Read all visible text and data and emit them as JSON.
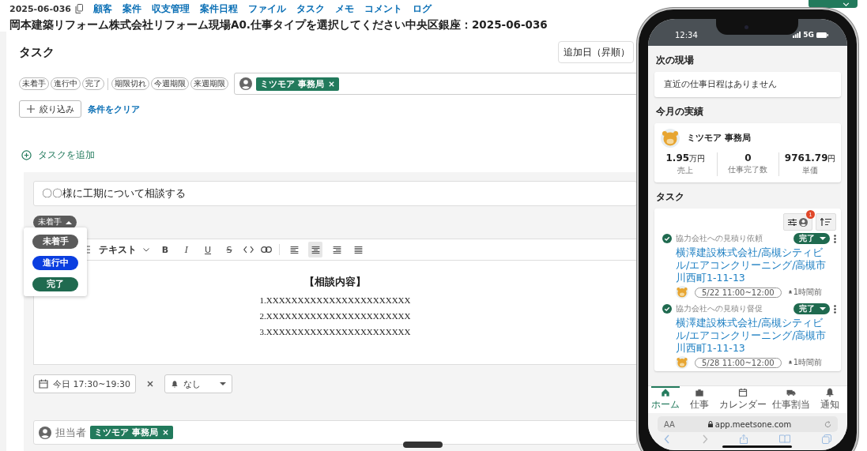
{
  "header": {
    "case_id": "2025-06-036",
    "nav": [
      "顧客",
      "案件",
      "収支管理",
      "案件日程",
      "ファイル",
      "タスク",
      "メモ",
      "コメント",
      "ログ"
    ],
    "title": "岡本建築リフォーム株式会社リフォーム現場A0.仕事タイプを選択してください中央区銀座：2025-06-036"
  },
  "tasks_panel": {
    "title": "タスク",
    "sort": "追加日（昇順）",
    "status_filters": [
      "未着手",
      "進行中",
      "完了"
    ],
    "deadline_filters": [
      "期限切れ",
      "今週期限",
      "来週期限"
    ],
    "assignee_tags": [
      "ミツモア 事務局"
    ],
    "filter_button": "絞り込み",
    "clear_link": "条件をクリア",
    "add_task": "タスクを追加"
  },
  "task_editor": {
    "title": "〇〇様に工期について相談する",
    "status": "未着手",
    "status_menu": [
      {
        "label": "未着手",
        "color": "#5b5b5b"
      },
      {
        "label": "進行中",
        "color": "#0a3ee0"
      },
      {
        "label": "完了",
        "color": "#1f6a4f"
      }
    ],
    "toolbar": {
      "text_style": "テキスト",
      "formats": [
        "B",
        "I",
        "U",
        "S"
      ],
      "alignments": [
        {
          "selected": false
        },
        {
          "selected": true
        },
        {
          "selected": false
        },
        {
          "selected": false
        }
      ]
    },
    "content": {
      "heading": "【相談内容】",
      "lines": [
        "1.XXXXXXXXXXXXXXXXXXXXXXX",
        "2.XXXXXXXXXXXXXXXXXXXXXXX",
        "3.XXXXXXXXXXXXXXXXXXXXXXX"
      ]
    },
    "schedule": "今日 17:30~19:30",
    "reminder": "なし",
    "assignee": {
      "placeholder": "担当者",
      "tags": [
        "ミツモア 事務局"
      ]
    }
  },
  "phone": {
    "time": "12:34",
    "network": "5G",
    "next_site": {
      "title": "次の現場",
      "empty": "直近の仕事日程はありません"
    },
    "monthly": {
      "title": "今月の実績",
      "user": "ミツモア 事務局",
      "stats": [
        {
          "value": "1.95",
          "unit": "万円",
          "label": "売上"
        },
        {
          "value": "0",
          "label": "仕事完了数"
        },
        {
          "value": "9761.79",
          "unit": "円",
          "label": "単価"
        }
      ]
    },
    "tasks": {
      "title": "タスク",
      "filter_badge": "1",
      "items": [
        {
          "title": "協力会社への見積り依頼",
          "done": true,
          "status": "完了",
          "link": "横澤建設株式会社/高槻シティビル/エアコンクリーニング/高槻市川西町1-11-13",
          "time": "5/22 11:00~12:00",
          "reminder": "1時間前"
        },
        {
          "title": "協力会社への見積り督促",
          "done": true,
          "status": "完了",
          "link": "横澤建設株式会社/高槻シティビル/エアコンクリーニング/高槻市川西町1-11-13",
          "time": "5/28 11:00~12:00",
          "reminder": "1時間前"
        }
      ]
    },
    "tab_bar": [
      {
        "label": "ホーム",
        "selected": true
      },
      {
        "label": "仕事",
        "selected": false
      },
      {
        "label": "カレンダー",
        "selected": false
      },
      {
        "label": "仕事割当",
        "selected": false
      },
      {
        "label": "通知",
        "selected": false
      }
    ],
    "reader_label": "AA",
    "url": "app.meetsone.com"
  }
}
